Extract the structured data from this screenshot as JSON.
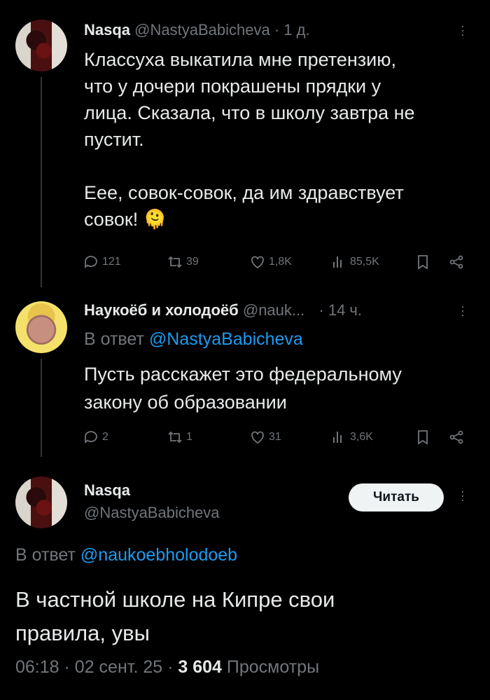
{
  "tweet1": {
    "display_name": "Nasqa",
    "handle": "@NastyaBabicheva",
    "time": "1 д.",
    "text_line1": "Классуха выкатила мне претензию,",
    "text_line2": "что у дочери покрашены прядки у",
    "text_line3": "лица. Сказала, что в школу завтра не",
    "text_line4": "пустит.",
    "text_line5": "Еее, совок-совок, да им здравствует",
    "text_line6": "совок!",
    "emoji": "🫠",
    "replies": "121",
    "reposts": "39",
    "likes": "1,8K",
    "views": "85,5K"
  },
  "tweet2": {
    "display_name": "Наукоёб и холодоёб",
    "handle": "@nauk...",
    "time": "14 ч.",
    "reply_prefix": "В ответ",
    "reply_to": "@NastyaBabicheva",
    "text_line1": "Пусть расскажет это федеральному",
    "text_line2": "закону об образовании",
    "replies": "2",
    "reposts": "1",
    "likes": "31",
    "views": "3,6K"
  },
  "tweet3": {
    "display_name": "Nasqa",
    "handle": "@NastyaBabicheva",
    "follow_label": "Читать",
    "reply_prefix": "В ответ",
    "reply_to": "@naukoebholodoeb",
    "text_line1": "В частной школе на Кипре свои",
    "text_line2": "правила, увы",
    "time": "06:18",
    "date": "02 сент. 25",
    "views_count": "3 604",
    "views_label": "Просмотры"
  },
  "colors": {
    "accent": "#1d9bf0",
    "muted": "#71767b",
    "text": "#e7e9ea",
    "background": "#000000"
  }
}
